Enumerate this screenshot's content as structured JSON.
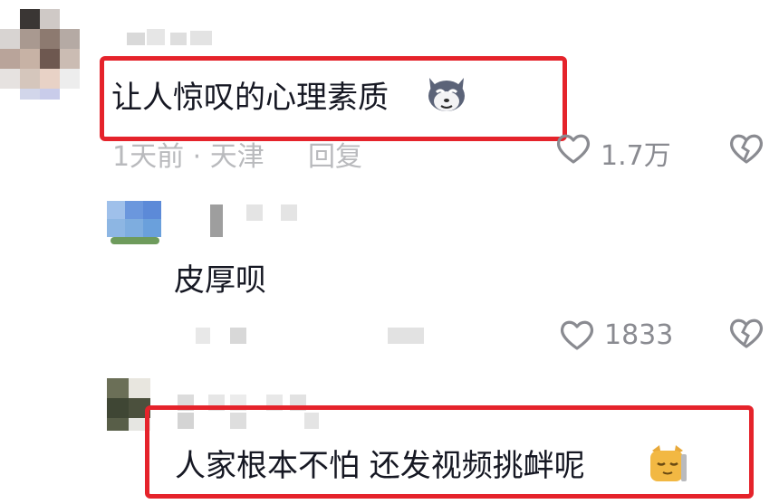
{
  "comments": [
    {
      "text": "让人惊叹的心理素质",
      "emoji": "husky-emoji",
      "meta": "1天前 · 天津",
      "reply_label": "回复",
      "likes": "1.7万",
      "highlighted": true
    },
    {
      "text": "皮厚呗",
      "likes": "1833",
      "highlighted": false
    },
    {
      "text": "人家根本不怕 还发视频挑衅呢",
      "emoji": "cat-emoji",
      "highlighted": true
    }
  ],
  "colors": {
    "highlight": "#e5232b",
    "meta": "#b9babd",
    "text": "#161823"
  },
  "icons": {
    "like": "heart-outline-icon",
    "dislike": "broken-heart-icon"
  }
}
